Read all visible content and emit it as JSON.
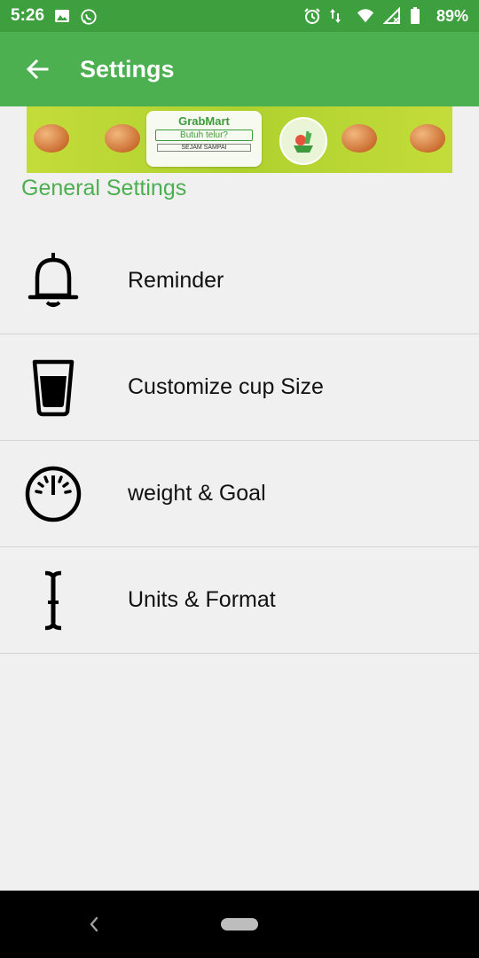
{
  "status_bar": {
    "time": "5:26",
    "battery": "89%",
    "icons": [
      "image-icon",
      "whatsapp-icon",
      "alarm-icon",
      "data-arrows-icon",
      "wifi-icon",
      "signal-icon",
      "battery-icon"
    ]
  },
  "app_bar": {
    "title": "Settings",
    "back_icon": "arrow-back-icon",
    "color": "#4caf50"
  },
  "ad": {
    "brand": "GrabMart",
    "tagline": "Butuh telur?",
    "subline": "SEJAM SAMPAI"
  },
  "section": {
    "title": "General Settings",
    "color": "#4caf50"
  },
  "items": [
    {
      "label": "Reminder",
      "icon": "bell-icon"
    },
    {
      "label": "Customize cup Size",
      "icon": "cup-icon"
    },
    {
      "label": "weight & Goal",
      "icon": "scale-icon"
    },
    {
      "label": "Units & Format",
      "icon": "text-cursor-icon"
    }
  ],
  "nav_bar": {
    "back_icon": "nav-back-icon",
    "home_icon": "home-pill-icon"
  }
}
